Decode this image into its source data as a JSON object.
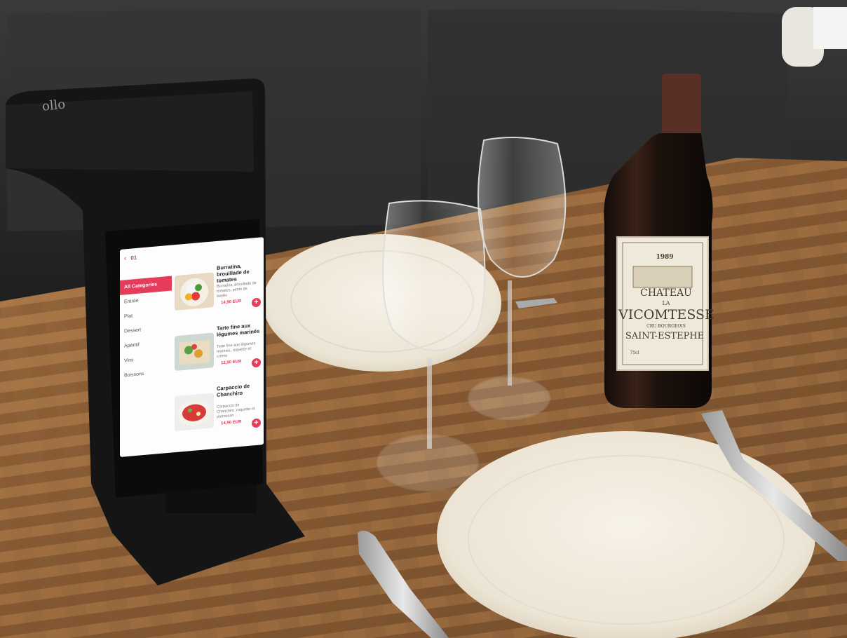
{
  "tablet": {
    "brand": "ollo",
    "table_number": "01",
    "back_icon": "chevron-left-icon",
    "categories": [
      {
        "label": "All Categories",
        "active": true
      },
      {
        "label": "Entrée",
        "active": false
      },
      {
        "label": "Plat",
        "active": false
      },
      {
        "label": "Dessert",
        "active": false
      },
      {
        "label": "Apéritif",
        "active": false
      },
      {
        "label": "Vins",
        "active": false
      },
      {
        "label": "Boissons",
        "active": false
      }
    ],
    "dishes": [
      {
        "name": "Burratina, brouillade de tomates",
        "desc": "Burratina, brouillade de tomates, pesto de basilic",
        "price": "14,90 EUR",
        "add": "+"
      },
      {
        "name": "Tarte fine aux légumes marinés",
        "desc": "Tarte fine aux légumes marinés, roquette et crème",
        "price": "12,90 EUR",
        "add": "+"
      },
      {
        "name": "Carpaccio de Chanchiro",
        "desc": "Carpaccio de Chanchiro, roquette et parmesan",
        "price": "14,90 EUR",
        "add": "+"
      }
    ],
    "accent_color": "#e63c5c"
  },
  "wine_label": {
    "year": "1989",
    "line1": "CHATEAU",
    "line2": "LA",
    "line3": "VICOMTESSE",
    "line4": "CRU BOURGEOIS",
    "line5": "SAINT-ESTEPHE",
    "volume": "75cl"
  },
  "colors": {
    "table_wood": "#9a6a3e",
    "sofa": "#2b2b2b",
    "plate": "#f2ece1",
    "bottle": "#1a120e",
    "label": "#efe9dc"
  }
}
